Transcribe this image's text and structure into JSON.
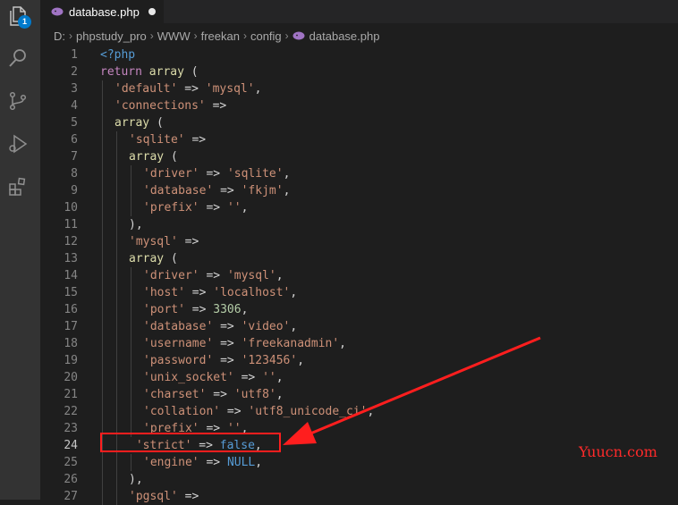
{
  "tab": {
    "filename": "database.php"
  },
  "breadcrumb": [
    "D:",
    "phpstudy_pro",
    "WWW",
    "freekan",
    "config",
    "database.php"
  ],
  "activity": {
    "badge_count": "1"
  },
  "active_line": 24,
  "code_lines": [
    {
      "n": "1",
      "indent": 0,
      "tokens": [
        [
          "tag",
          "<?php"
        ]
      ]
    },
    {
      "n": "2",
      "indent": 0,
      "tokens": [
        [
          "k",
          "return "
        ],
        [
          "kw",
          "array"
        ],
        [
          "p",
          " ("
        ]
      ]
    },
    {
      "n": "3",
      "indent": 1,
      "tokens": [
        [
          "s",
          "'default'"
        ],
        [
          "p",
          " => "
        ],
        [
          "s",
          "'mysql'"
        ],
        [
          "p",
          ","
        ]
      ]
    },
    {
      "n": "4",
      "indent": 1,
      "tokens": [
        [
          "s",
          "'connections'"
        ],
        [
          "p",
          " =>"
        ]
      ]
    },
    {
      "n": "5",
      "indent": 1,
      "tokens": [
        [
          "kw",
          "array"
        ],
        [
          "p",
          " ("
        ]
      ]
    },
    {
      "n": "6",
      "indent": 2,
      "tokens": [
        [
          "s",
          "'sqlite'"
        ],
        [
          "p",
          " =>"
        ]
      ]
    },
    {
      "n": "7",
      "indent": 2,
      "tokens": [
        [
          "kw",
          "array"
        ],
        [
          "p",
          " ("
        ]
      ]
    },
    {
      "n": "8",
      "indent": 3,
      "tokens": [
        [
          "s",
          "'driver'"
        ],
        [
          "p",
          " => "
        ],
        [
          "s",
          "'sqlite'"
        ],
        [
          "p",
          ","
        ]
      ]
    },
    {
      "n": "9",
      "indent": 3,
      "tokens": [
        [
          "s",
          "'database'"
        ],
        [
          "p",
          " => "
        ],
        [
          "s",
          "'fkjm'"
        ],
        [
          "p",
          ","
        ]
      ]
    },
    {
      "n": "10",
      "indent": 3,
      "tokens": [
        [
          "s",
          "'prefix'"
        ],
        [
          "p",
          " => "
        ],
        [
          "s",
          "''"
        ],
        [
          "p",
          ","
        ]
      ]
    },
    {
      "n": "11",
      "indent": 2,
      "tokens": [
        [
          "p",
          "),"
        ]
      ]
    },
    {
      "n": "12",
      "indent": 2,
      "tokens": [
        [
          "s",
          "'mysql'"
        ],
        [
          "p",
          " =>"
        ]
      ]
    },
    {
      "n": "13",
      "indent": 2,
      "tokens": [
        [
          "kw",
          "array"
        ],
        [
          "p",
          " ("
        ]
      ]
    },
    {
      "n": "14",
      "indent": 3,
      "tokens": [
        [
          "s",
          "'driver'"
        ],
        [
          "p",
          " => "
        ],
        [
          "s",
          "'mysql'"
        ],
        [
          "p",
          ","
        ]
      ]
    },
    {
      "n": "15",
      "indent": 3,
      "tokens": [
        [
          "s",
          "'host'"
        ],
        [
          "p",
          " => "
        ],
        [
          "s",
          "'localhost'"
        ],
        [
          "p",
          ","
        ]
      ]
    },
    {
      "n": "16",
      "indent": 3,
      "tokens": [
        [
          "s",
          "'port'"
        ],
        [
          "p",
          " => "
        ],
        [
          "n",
          "3306"
        ],
        [
          "p",
          ","
        ]
      ]
    },
    {
      "n": "17",
      "indent": 3,
      "tokens": [
        [
          "s",
          "'database'"
        ],
        [
          "p",
          " => "
        ],
        [
          "s",
          "'video'"
        ],
        [
          "p",
          ","
        ]
      ]
    },
    {
      "n": "18",
      "indent": 3,
      "tokens": [
        [
          "s",
          "'username'"
        ],
        [
          "p",
          " => "
        ],
        [
          "s",
          "'freekanadmin'"
        ],
        [
          "p",
          ","
        ]
      ]
    },
    {
      "n": "19",
      "indent": 3,
      "tokens": [
        [
          "s",
          "'password'"
        ],
        [
          "p",
          " => "
        ],
        [
          "s",
          "'123456'"
        ],
        [
          "p",
          ","
        ]
      ]
    },
    {
      "n": "20",
      "indent": 3,
      "tokens": [
        [
          "s",
          "'unix_socket'"
        ],
        [
          "p",
          " => "
        ],
        [
          "s",
          "''"
        ],
        [
          "p",
          ","
        ]
      ]
    },
    {
      "n": "21",
      "indent": 3,
      "tokens": [
        [
          "s",
          "'charset'"
        ],
        [
          "p",
          " => "
        ],
        [
          "s",
          "'utf8'"
        ],
        [
          "p",
          ","
        ]
      ]
    },
    {
      "n": "22",
      "indent": 3,
      "tokens": [
        [
          "s",
          "'collation'"
        ],
        [
          "p",
          " => "
        ],
        [
          "s",
          "'utf8_unicode_ci'"
        ],
        [
          "p",
          ","
        ]
      ]
    },
    {
      "n": "23",
      "indent": 3,
      "tokens": [
        [
          "s",
          "'prefix'"
        ],
        [
          "p",
          " => "
        ],
        [
          "s",
          "''"
        ],
        [
          "p",
          ","
        ]
      ]
    },
    {
      "n": "24",
      "indent": 2,
      "tokens": [
        [
          "s",
          " 'strict'"
        ],
        [
          "p",
          " => "
        ],
        [
          "c",
          "false"
        ],
        [
          "p",
          ","
        ]
      ]
    },
    {
      "n": "25",
      "indent": 3,
      "tokens": [
        [
          "s",
          "'engine'"
        ],
        [
          "p",
          " => "
        ],
        [
          "c",
          "NULL"
        ],
        [
          "p",
          ","
        ]
      ]
    },
    {
      "n": "26",
      "indent": 2,
      "tokens": [
        [
          "p",
          "),"
        ]
      ]
    },
    {
      "n": "27",
      "indent": 2,
      "tokens": [
        [
          "s",
          "'pgsql'"
        ],
        [
          "p",
          " =>"
        ]
      ]
    }
  ],
  "watermark": "Yuucn.com",
  "colors": {
    "annotation": "#ff1e1e",
    "string": "#ce9178",
    "constant": "#569cd6",
    "number": "#b5cea8"
  },
  "icons": [
    "explorer-icon",
    "search-icon",
    "source-control-icon",
    "run-debug-icon",
    "extensions-icon",
    "php-file-icon",
    "chevron-right-icon"
  ]
}
